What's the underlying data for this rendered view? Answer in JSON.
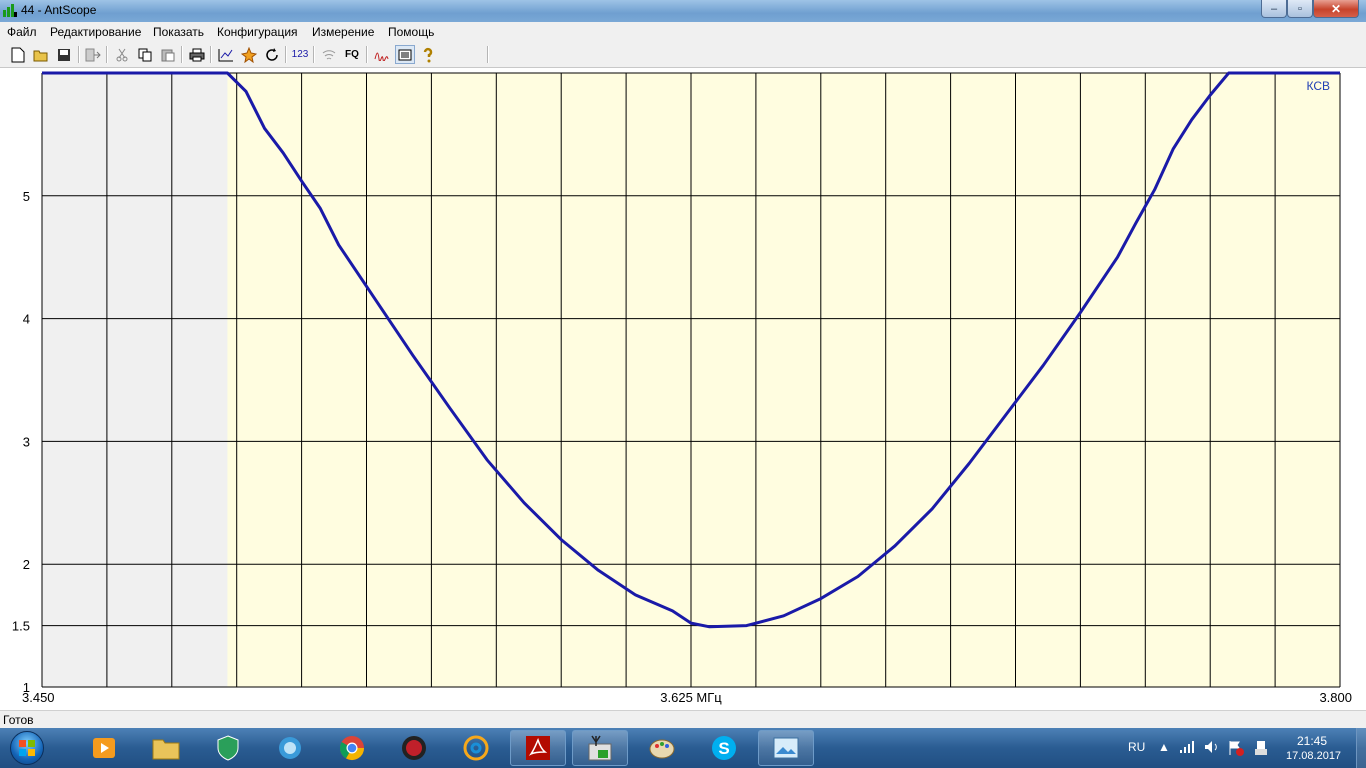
{
  "window": {
    "title": "44 - AntScope",
    "controls": {
      "minimize": "–",
      "maximize": "▫",
      "close": "✕"
    }
  },
  "menu": [
    "Файл",
    "Редактирование",
    "Показать",
    "Конфигурация",
    "Измерение",
    "Помощь"
  ],
  "toolbar": {
    "icons": [
      "new-file-icon",
      "open-folder-icon",
      "save-icon",
      "export-icon",
      "cut-icon",
      "copy-icon",
      "paste-icon",
      "print-icon",
      "chart-icon",
      "marker-icon",
      "refresh-icon",
      "numeric-icon",
      "wireless-icon",
      "frequency-icon",
      "curve-icon",
      "log-icon",
      "help-icon"
    ],
    "numeric_label": "123",
    "fq_label": "FQ"
  },
  "chart_data": {
    "type": "line",
    "series_label": "КСВ",
    "x_tick_labels": [
      "3.450",
      "3.625 МГц",
      "3.800"
    ],
    "y_tick_labels": [
      "5",
      "4",
      "3",
      "2",
      "1.5",
      "1"
    ],
    "x_range": [
      3.45,
      3.8
    ],
    "y_range": [
      1,
      6
    ],
    "marker_x": 3.625,
    "shaded_region": [
      3.45,
      3.5
    ],
    "grid": true,
    "colors": {
      "line": "#1a1aa8",
      "plot_bg": "#fffde0",
      "shaded_bg": "#f0f0f0",
      "grid": "#000000"
    },
    "series": [
      {
        "name": "КСВ",
        "x": [
          3.45,
          3.5,
          3.505,
          3.51,
          3.515,
          3.52,
          3.525,
          3.53,
          3.54,
          3.55,
          3.56,
          3.57,
          3.58,
          3.59,
          3.6,
          3.61,
          3.62,
          3.625,
          3.63,
          3.64,
          3.65,
          3.66,
          3.67,
          3.68,
          3.69,
          3.7,
          3.71,
          3.72,
          3.73,
          3.74,
          3.745,
          3.75,
          3.755,
          3.76,
          3.765,
          3.77,
          3.8
        ],
        "y": [
          6.0,
          6.0,
          5.85,
          5.55,
          5.35,
          5.12,
          4.9,
          4.6,
          4.15,
          3.7,
          3.27,
          2.85,
          2.5,
          2.2,
          1.95,
          1.75,
          1.62,
          1.52,
          1.49,
          1.5,
          1.58,
          1.72,
          1.9,
          2.15,
          2.45,
          2.82,
          3.22,
          3.62,
          4.05,
          4.5,
          4.78,
          5.05,
          5.38,
          5.62,
          5.82,
          6.0,
          6.0
        ]
      }
    ]
  },
  "status": "Готов",
  "taskbar": {
    "apps": [
      "media-player-icon",
      "file-explorer-icon",
      "kaspersky-icon",
      "ie-browser-icon",
      "chrome-icon",
      "game-app-icon",
      "mail-agent-icon",
      "pdf-reader-icon",
      "antscope-icon",
      "paint-icon",
      "skype-icon",
      "photo-viewer-icon"
    ],
    "tray": {
      "language": "RU",
      "time": "21:45",
      "date": "17.08.2017"
    }
  }
}
